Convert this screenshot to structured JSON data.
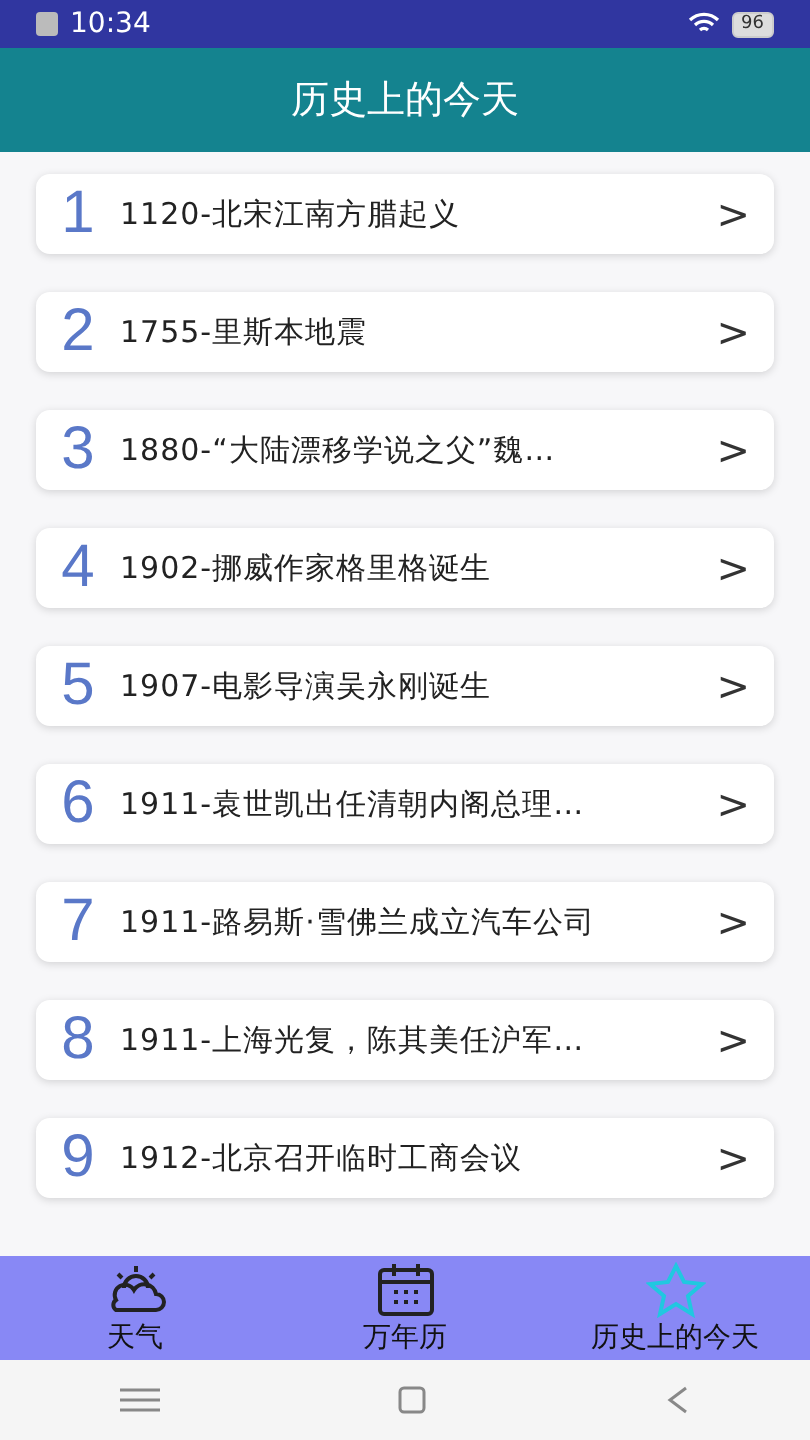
{
  "status_bar": {
    "time": "10:34",
    "battery": "96"
  },
  "header": {
    "title": "历史上的今天"
  },
  "events": [
    {
      "number": "1",
      "text": "1120-北宋江南方腊起义",
      "arrow": ">"
    },
    {
      "number": "2",
      "text": "1755-里斯本地震",
      "arrow": ">"
    },
    {
      "number": "3",
      "text": "1880-“大陆漂移学说之父”魏…",
      "arrow": ">"
    },
    {
      "number": "4",
      "text": "1902-挪威作家格里格诞生",
      "arrow": ">"
    },
    {
      "number": "5",
      "text": "1907-电影导演吴永刚诞生",
      "arrow": ">"
    },
    {
      "number": "6",
      "text": "1911-袁世凯出任清朝内阁总理…",
      "arrow": ">"
    },
    {
      "number": "7",
      "text": "1911-路易斯·雪佛兰成立汽车公司",
      "arrow": ">"
    },
    {
      "number": "8",
      "text": "1911-上海光复，陈其美任沪军…",
      "arrow": ">"
    },
    {
      "number": "9",
      "text": "1912-北京召开临时工商会议",
      "arrow": ">"
    }
  ],
  "tabs": [
    {
      "kind": "weather",
      "label": "天气",
      "selected": false
    },
    {
      "kind": "calendar",
      "label": "万年历",
      "selected": false
    },
    {
      "kind": "star",
      "label": "历史上的今天",
      "selected": true
    }
  ]
}
